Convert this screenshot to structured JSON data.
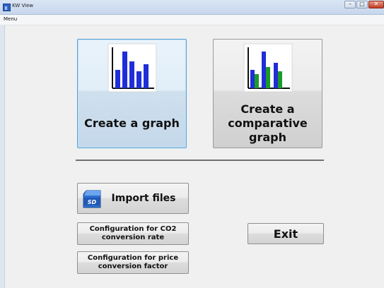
{
  "window": {
    "title": "KW View",
    "buttons": {
      "minimize": "–",
      "maximize": "□",
      "close": "✕"
    }
  },
  "menu": {
    "items": [
      {
        "label": "Menu"
      }
    ]
  },
  "tiles": {
    "create_graph": {
      "label": "Create a graph",
      "icon": "bar-chart-icon"
    },
    "create_comparative": {
      "label": "Create a comparative graph",
      "label_lines": [
        "Create a",
        "comparative",
        "graph"
      ],
      "icon": "comparative-bar-chart-icon"
    }
  },
  "buttons": {
    "import_files": {
      "label": "Import files",
      "icon": "sd-card-icon"
    },
    "config_co2": {
      "label_lines": [
        "Configuration for CO2",
        "conversion rate"
      ]
    },
    "config_price": {
      "label_lines": [
        "Configuration for price",
        "conversion factor"
      ]
    },
    "exit": {
      "label": "Exit"
    }
  },
  "colors": {
    "accent": "#5aa1d6",
    "bar_blue": "#1f2ed8",
    "bar_green": "#1b9a2a"
  }
}
